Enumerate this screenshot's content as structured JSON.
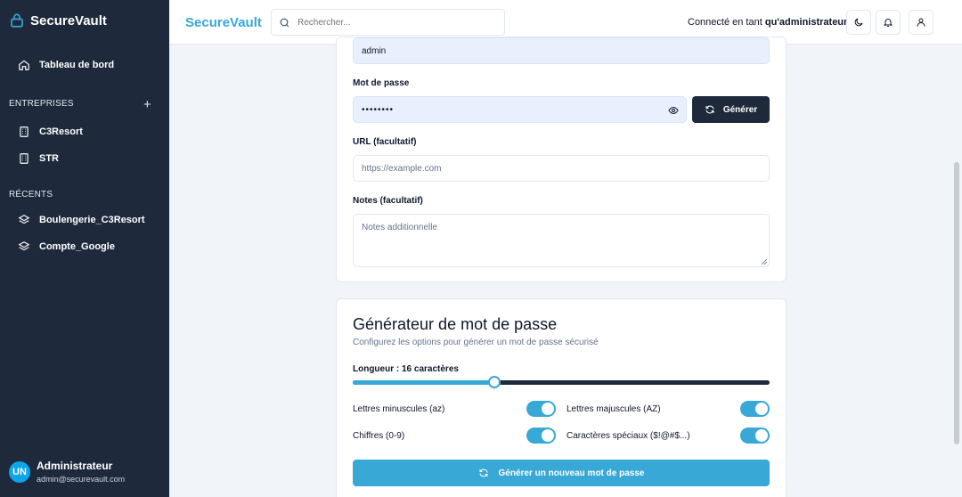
{
  "sidebar": {
    "brand": "SecureVault",
    "dashboard_label": "Tableau de bord",
    "companies_section": "ENTREPRISES",
    "add_icon": "+",
    "companies": [
      {
        "label": "C3Resort",
        "icon": "building-icon"
      },
      {
        "label": "STR",
        "icon": "building-icon"
      }
    ],
    "recent_section": "RÉCENTS",
    "recent": [
      {
        "label": "Boulengerie_C3Resort",
        "icon": "layers-icon"
      },
      {
        "label": "Compte_Google",
        "icon": "layers-icon"
      }
    ],
    "user": {
      "initials": "UN",
      "name": "Administrateur",
      "email": "admin@securevault.com"
    }
  },
  "header": {
    "brand": "SecureVault",
    "search_placeholder": "Rechercher...",
    "connected_prefix": "Connecté en tant ",
    "connected_user": "qu'administrateur",
    "icons": [
      "moon-icon",
      "bell-icon",
      "user-icon"
    ]
  },
  "form": {
    "username_value": "admin",
    "password_label": "Mot de passe",
    "password_value": "••••••••",
    "generate_label": "Générer",
    "url_label": "URL (facultatif)",
    "url_placeholder": "https://example.com",
    "notes_label": "Notes (facultatif)",
    "notes_placeholder": "Notes additionnelle"
  },
  "generator": {
    "title": "Générateur de mot de passe",
    "subtitle": "Configurez les options pour générer un mot de passe sécurisé",
    "length_label": "Longueur : 16 caractères",
    "length_fraction": 0.34,
    "options": [
      {
        "label": "Lettres minuscules (az)",
        "enabled": true
      },
      {
        "label": "Lettres majuscules (AZ)",
        "enabled": true
      },
      {
        "label": "Chiffres (0-9)",
        "enabled": true
      },
      {
        "label": "Caractères spéciaux ($!@#$...)",
        "enabled": true
      }
    ],
    "new_button": "Générer un nouveau mot de passe"
  },
  "colors": {
    "accent": "#38a8d6",
    "sidebar_bg": "#1e293b"
  }
}
